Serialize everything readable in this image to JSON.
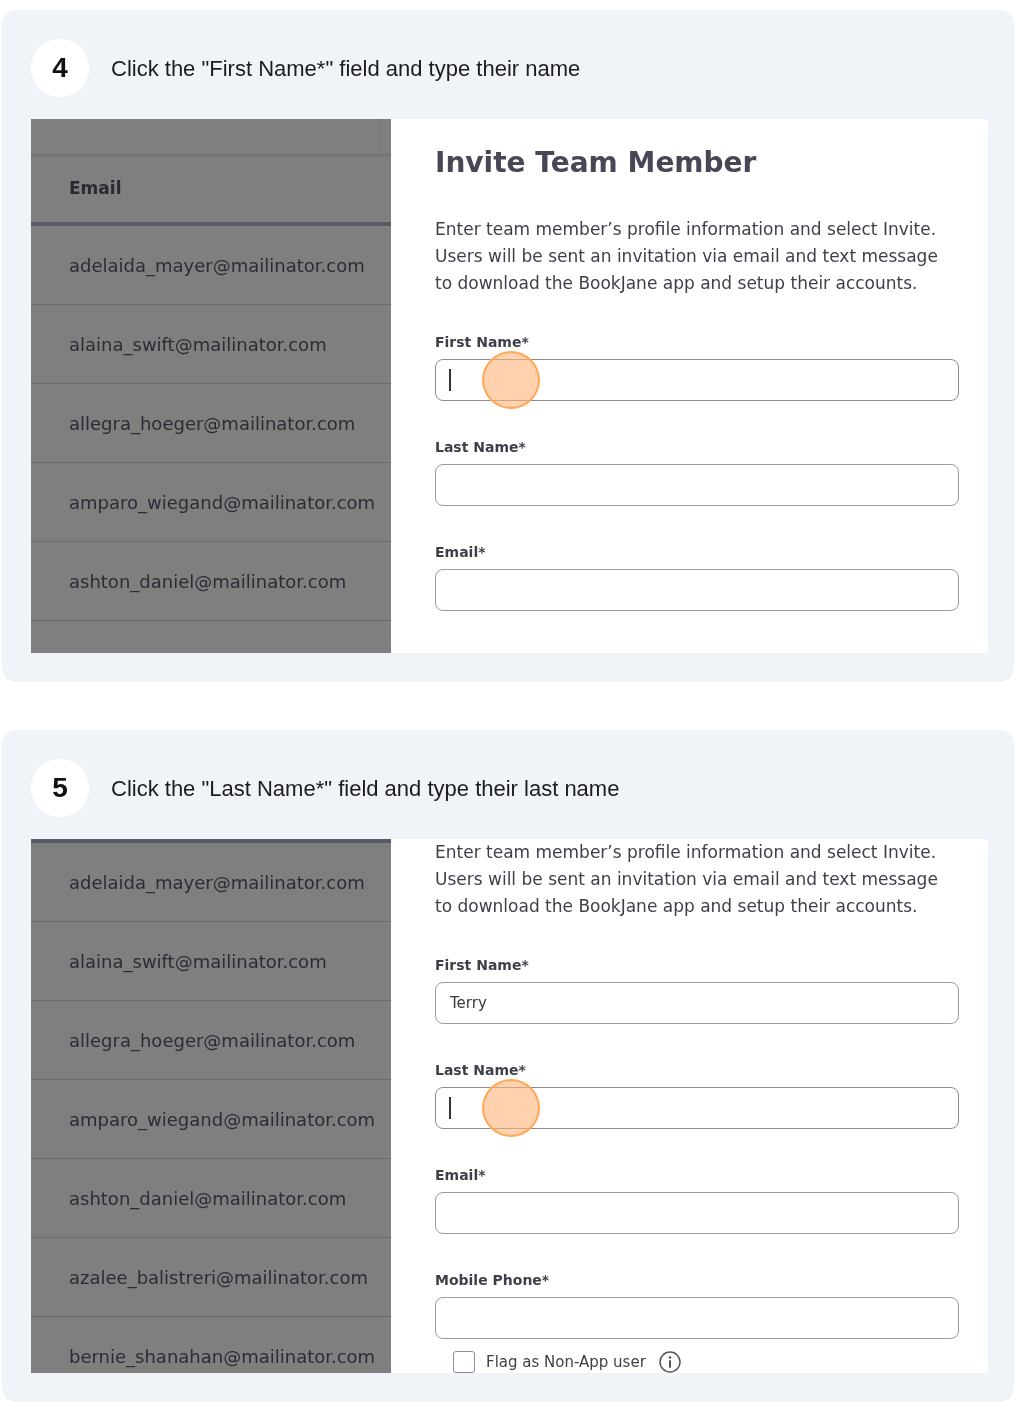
{
  "steps": [
    {
      "number": "4",
      "instruction": "Click the \"First Name*\" field and type their name",
      "table": {
        "column_header": "Email",
        "rows": [
          "adelaida_mayer@mailinator.com",
          "alaina_swift@mailinator.com",
          "allegra_hoeger@mailinator.com",
          "amparo_wiegand@mailinator.com",
          "ashton_daniel@mailinator.com"
        ]
      },
      "form": {
        "title": "Invite Team Member",
        "description": "Enter team member’s profile information and select Invite. Users will be sent an invitation via email and text message to download the BookJane app and setup their accounts.",
        "fields": [
          {
            "label": "First Name*",
            "focused": true
          },
          {
            "label": "Last Name*",
            "focused": false
          },
          {
            "label": "Email*",
            "focused": false
          }
        ]
      }
    },
    {
      "number": "5",
      "instruction": "Click the \"Last Name*\" field and type their last name",
      "table": {
        "rows": [
          "adelaida_mayer@mailinator.com",
          "alaina_swift@mailinator.com",
          "allegra_hoeger@mailinator.com",
          "amparo_wiegand@mailinator.com",
          "ashton_daniel@mailinator.com",
          "azalee_balistreri@mailinator.com",
          "bernie_shanahan@mailinator.com"
        ]
      },
      "form": {
        "description": "Enter team member’s profile information and select Invite. Users will be sent an invitation via email and text message to download the BookJane app and setup their accounts.",
        "fields": [
          {
            "label": "First Name*",
            "value": "Terry",
            "focused": false
          },
          {
            "label": "Last Name*",
            "focused": true
          },
          {
            "label": "Email*",
            "focused": false
          },
          {
            "label": "Mobile Phone*",
            "focused": false
          }
        ],
        "checkbox": {
          "label": "Flag as Non-App user",
          "checked": false
        }
      }
    }
  ]
}
